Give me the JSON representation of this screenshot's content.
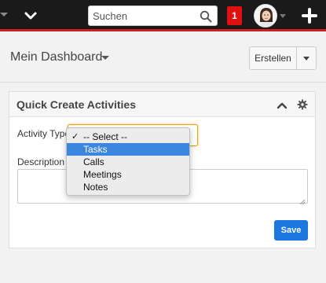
{
  "topbar": {
    "search": {
      "placeholder": "Suchen",
      "value": ""
    },
    "notification_count": "1",
    "icons": [
      "chevron-down-icon",
      "search-icon",
      "avatar",
      "plus-icon"
    ]
  },
  "header": {
    "title": "Mein Dashboard",
    "create_button": "Erstellen"
  },
  "dashlet": {
    "title": "Quick Create Activities",
    "activity_type_label": "Activity Type",
    "description_label": "Description",
    "description_value": "",
    "save_label": "Save"
  },
  "activity_type_dropdown": {
    "selected": "-- Select --",
    "highlighted": "Tasks",
    "options": [
      {
        "label": "-- Select --",
        "checked": true
      },
      {
        "label": "Tasks",
        "highlighted": true
      },
      {
        "label": "Calls"
      },
      {
        "label": "Meetings"
      },
      {
        "label": "Notes"
      }
    ]
  },
  "colors": {
    "topbar": "#1a1a1a",
    "topbar_accent": "#cc1f1f",
    "badge": "#e01010",
    "primary_button": "#1a78e0",
    "focus_border": "#e8a317",
    "dropdown_highlight": "#3b87e0"
  }
}
